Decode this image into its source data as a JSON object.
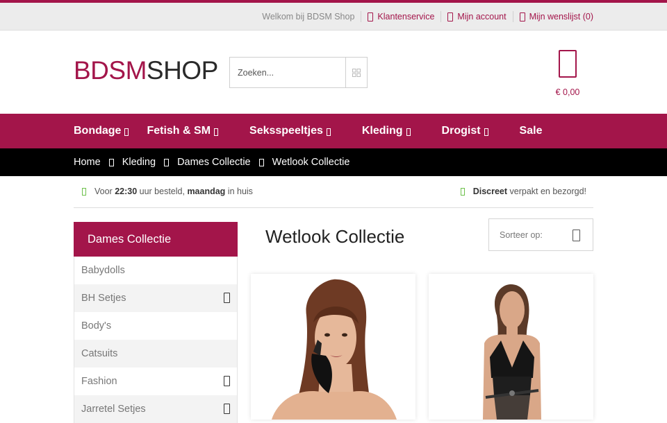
{
  "topbar": {
    "welcome": "Welkom bij BDSM Shop",
    "customer_service": "Klantenservice",
    "account": "Mijn account",
    "wishlist": "Mijn wenslijst (0)"
  },
  "header": {
    "logo_part1": "BDSM",
    "logo_part2": "SHOP",
    "search_placeholder": "Zoeken...",
    "search_icon": "grid-icon",
    "cart_icon": "shopping-bag-icon",
    "cart_total": "€ 0,00"
  },
  "nav": {
    "items": [
      {
        "label": "Bondage",
        "has_dropdown": true
      },
      {
        "label": "Fetish & SM",
        "has_dropdown": true
      },
      {
        "label": "Seksspeeltjes",
        "has_dropdown": true
      },
      {
        "label": "Kleding",
        "has_dropdown": true
      },
      {
        "label": "Drogist",
        "has_dropdown": true
      },
      {
        "label": "Sale",
        "has_dropdown": false
      }
    ]
  },
  "breadcrumb": {
    "items": [
      "Home",
      "Kleding",
      "Dames Collectie",
      "Wetlook Collectie"
    ]
  },
  "usp": {
    "left_pre": "Voor ",
    "left_time": "22:30",
    "left_mid": " uur besteld, ",
    "left_day": "maandag",
    "left_post": " in huis",
    "right_bold": "Discreet",
    "right_post": " verpakt en bezorgd!"
  },
  "sidebar": {
    "title": "Dames Collectie",
    "items": [
      {
        "label": "Babydolls",
        "expandable": false
      },
      {
        "label": "BH Setjes",
        "expandable": true
      },
      {
        "label": "Body's",
        "expandable": false
      },
      {
        "label": "Catsuits",
        "expandable": false
      },
      {
        "label": "Fashion",
        "expandable": true
      },
      {
        "label": "Jarretel Setjes",
        "expandable": true
      }
    ]
  },
  "main": {
    "title": "Wetlook Collectie",
    "sort_label": "Sorteer op:"
  },
  "colors": {
    "brand": "#a3154a",
    "breadcrumb_bg": "#000000",
    "check_green": "#6cc04a"
  }
}
